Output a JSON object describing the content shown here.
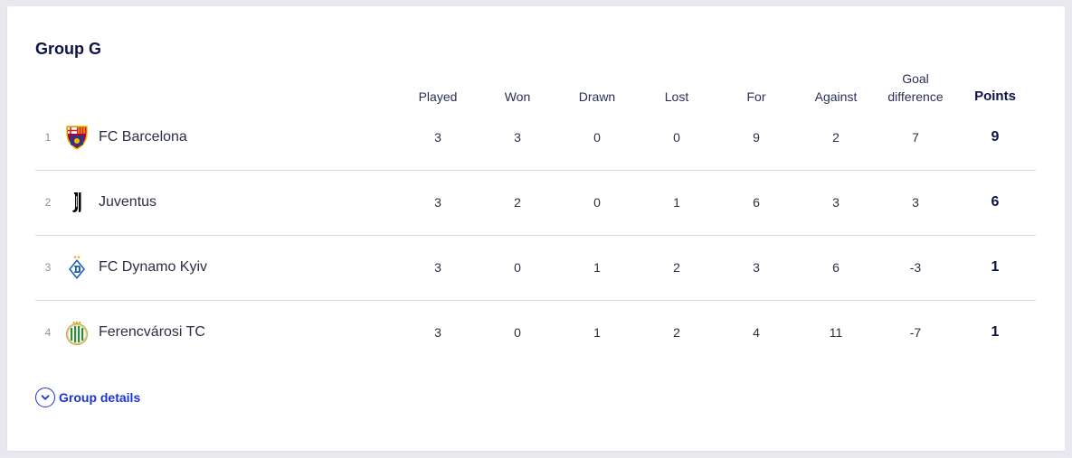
{
  "group": {
    "title": "Group G",
    "details_label": "Group details"
  },
  "columns": {
    "played": "Played",
    "won": "Won",
    "drawn": "Drawn",
    "lost": "Lost",
    "for": "For",
    "against": "Against",
    "goal_difference_line1": "Goal",
    "goal_difference_line2": "difference",
    "points": "Points"
  },
  "teams": [
    {
      "position": "1",
      "name": "FC Barcelona",
      "logo": "barcelona-crest-icon",
      "played": "3",
      "won": "3",
      "drawn": "0",
      "lost": "0",
      "for": "9",
      "against": "2",
      "goal_difference": "7",
      "points": "9"
    },
    {
      "position": "2",
      "name": "Juventus",
      "logo": "juventus-crest-icon",
      "played": "3",
      "won": "2",
      "drawn": "0",
      "lost": "1",
      "for": "6",
      "against": "3",
      "goal_difference": "3",
      "points": "6"
    },
    {
      "position": "3",
      "name": "FC Dynamo Kyiv",
      "logo": "dynamo-kyiv-crest-icon",
      "played": "3",
      "won": "0",
      "drawn": "1",
      "lost": "2",
      "for": "3",
      "against": "6",
      "goal_difference": "-3",
      "points": "1"
    },
    {
      "position": "4",
      "name": "Ferencvárosi TC",
      "logo": "ferencvaros-crest-icon",
      "played": "3",
      "won": "0",
      "drawn": "1",
      "lost": "2",
      "for": "4",
      "against": "11",
      "goal_difference": "-7",
      "points": "1"
    }
  ],
  "colors": {
    "accent": "#1d33d6",
    "title": "#0b1249",
    "divider": "#d9dbe3",
    "background": "#e8e9ef"
  }
}
